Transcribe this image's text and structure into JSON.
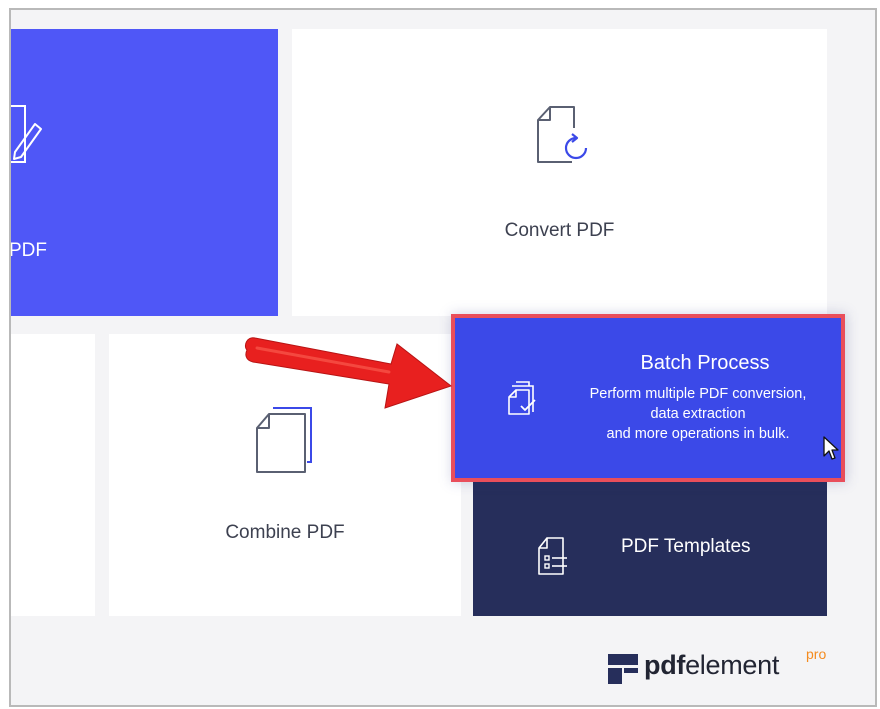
{
  "tiles": {
    "edit": {
      "label": "PDF"
    },
    "convert": {
      "label": "Convert PDF"
    },
    "combine": {
      "label": "Combine PDF"
    },
    "batch": {
      "title": "Batch Process",
      "description_lines": [
        "Perform multiple PDF conversion,",
        "data extraction",
        "and more operations in bulk."
      ]
    },
    "templates": {
      "label": "PDF Templates"
    }
  },
  "brand": {
    "bold": "pdf",
    "regular": "element",
    "suffix": "pro"
  },
  "colors": {
    "primary_blue": "#4f57f7",
    "batch_blue": "#3b49e8",
    "highlight_border": "#e94e5b",
    "navy": "#262e5b",
    "arrow_red": "#e8201f",
    "pro_orange": "#f58b1f"
  },
  "icons": {
    "edit": "edit-pdf-icon",
    "convert": "convert-pdf-icon",
    "combine": "combine-pdf-icon",
    "batch": "batch-process-icon",
    "templates": "pdf-templates-icon",
    "cursor": "mouse-pointer-icon",
    "arrow": "red-arrow-annotation",
    "logo": "pdfelement-logo-icon"
  }
}
